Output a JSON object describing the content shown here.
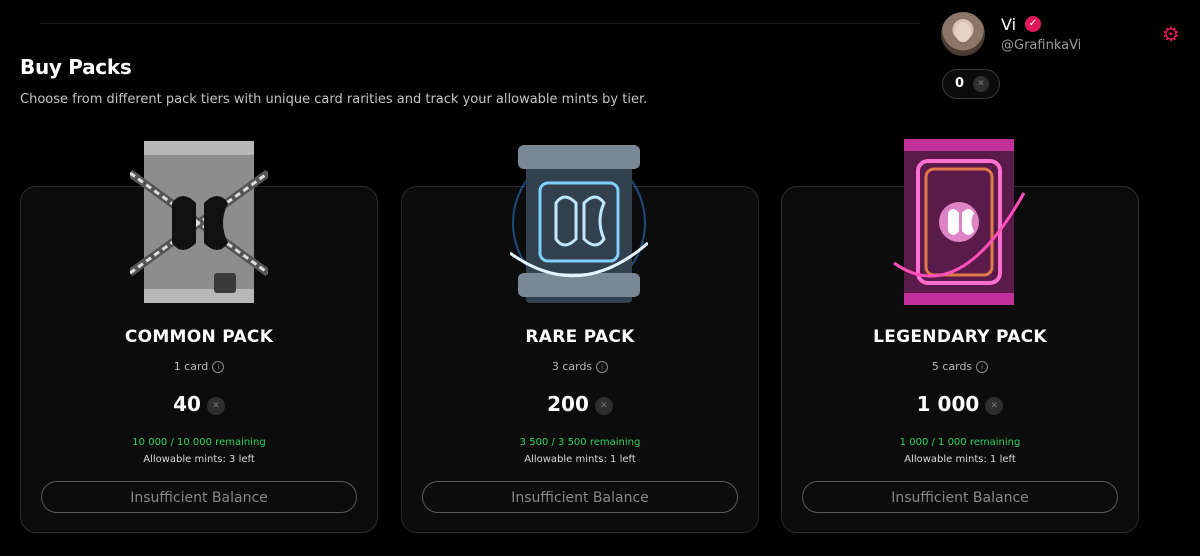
{
  "header": {
    "title": "Buy Packs",
    "subtitle": "Choose from different pack tiers with unique card rarities and track your allowable mints by tier."
  },
  "profile": {
    "name": "Vi",
    "handle": "@GrafinkaVi",
    "balance": "0",
    "verified_icon": "verified-badge-icon",
    "settings_icon": "gear-icon",
    "accent_color": "#e0195a"
  },
  "packs": [
    {
      "name": "COMMON PACK",
      "cards": "1 card",
      "price": "40",
      "remaining": "10 000 / 10 000 remaining",
      "mints": "Allowable mints: 3 left",
      "button": "Insufficient Balance",
      "color": "#c9c9c9"
    },
    {
      "name": "RARE PACK",
      "cards": "3 cards",
      "price": "200",
      "remaining": "3 500 / 3 500 remaining",
      "mints": "Allowable mints: 1 left",
      "button": "Insufficient Balance",
      "color": "#4fb6ff"
    },
    {
      "name": "LEGENDARY PACK",
      "cards": "5 cards",
      "price": "1 000",
      "remaining": "1 000 / 1 000 remaining",
      "mints": "Allowable mints: 1 left",
      "button": "Insufficient Balance",
      "color": "#ff3fae"
    }
  ],
  "status_color": "#2fd35f"
}
